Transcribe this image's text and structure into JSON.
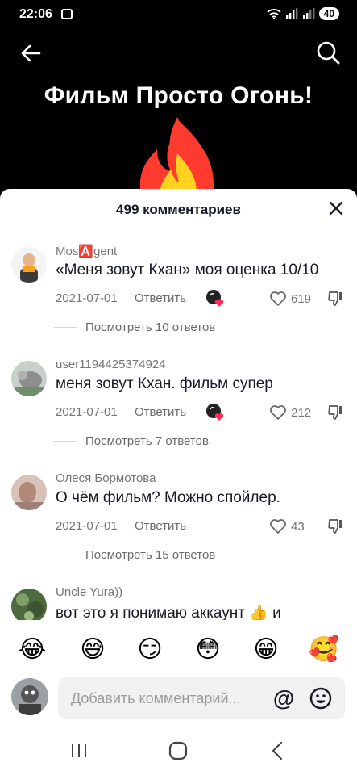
{
  "status": {
    "time": "22:06",
    "battery": "40"
  },
  "video": {
    "title": "Фильм Просто Огонь!"
  },
  "comments_header": {
    "count_label": "499 комментариев"
  },
  "comments": [
    {
      "user": "Mos🅰️gent",
      "text": "«Меня зовут Кхан» моя оценка 10/10",
      "date": "2021-07-01",
      "reply_label": "Ответить",
      "likes": "619",
      "view_replies": "Посмотреть 10 ответов",
      "avatar_color": "#f6c7a0"
    },
    {
      "user": "user1194425374924",
      "text": "меня зовут Кхан. фильм супер",
      "date": "2021-07-01",
      "reply_label": "Ответить",
      "likes": "212",
      "view_replies": "Посмотреть 7 ответов",
      "avatar_color": "#9aa39a"
    },
    {
      "user": "Олеся Бормотова",
      "text": "О чём фильм? Можно спойлер.",
      "date": "2021-07-01",
      "reply_label": "Ответить",
      "likes": "43",
      "view_replies": "Посмотреть 15 ответов",
      "avatar_color": "#c7a89a"
    },
    {
      "user": "Uncle Yura))",
      "text": "вот это я понимаю аккаунт 👍 и",
      "date": "",
      "reply_label": "",
      "likes": "",
      "view_replies": "",
      "avatar_color": "#5b7a4a"
    }
  ],
  "emoji_bar": [
    "😂",
    "😅",
    "😏",
    "😳",
    "😁",
    "🥰"
  ],
  "input": {
    "placeholder": "Добавить комментарий...",
    "at_symbol": "@"
  },
  "colors": {
    "like_red": "#fe2c55",
    "muted": "#757575",
    "text": "#161823"
  },
  "icons": [
    "back-arrow-icon",
    "search-icon",
    "close-icon",
    "heart-icon",
    "dislike-icon",
    "emoji-icon",
    "recents-icon",
    "home-icon",
    "back-nav-icon"
  ]
}
